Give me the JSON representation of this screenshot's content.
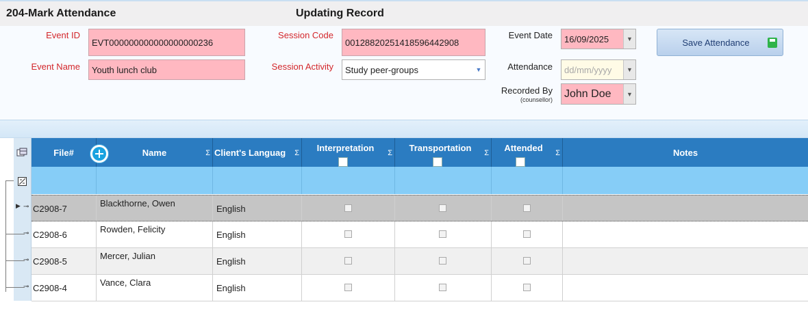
{
  "header": {
    "title": "204-Mark Attendance",
    "status": "Updating Record"
  },
  "form": {
    "event_id_label": "Event ID",
    "event_id_value": "EVT000000000000000000236",
    "event_name_label": "Event Name",
    "event_name_value": "Youth lunch club",
    "session_code_label": "Session Code",
    "session_code_value": "0012882025141859644290​8",
    "session_activity_label": "Session Activity",
    "session_activity_value": "Study peer-groups",
    "event_date_label": "Event Date",
    "event_date_value": "16/09/2025",
    "attendance_label": "Attendance",
    "attendance_placeholder": "dd/mm/yyyy",
    "recorded_by_label": "Recorded By",
    "recorded_by_sub": "(counsellor)",
    "recorded_by_value": "John Doe",
    "save_label": "Save Attendance"
  },
  "colors": {
    "accent": "#2b7cc1",
    "required": "#ffb8c1",
    "filter_row": "#86cdf7",
    "label_red": "#d3262a"
  },
  "grid": {
    "columns": [
      {
        "key": "file",
        "label": "File#"
      },
      {
        "key": "name",
        "label": "Name"
      },
      {
        "key": "language",
        "label": "Client's Languag"
      },
      {
        "key": "interpretation",
        "label": "Interpretation"
      },
      {
        "key": "transportation",
        "label": "Transportation"
      },
      {
        "key": "attended",
        "label": "Attended"
      },
      {
        "key": "notes",
        "label": "Notes"
      }
    ],
    "sigma": "Σ",
    "rows": [
      {
        "file": "C2908-7",
        "name": "Blackthorne, Owen",
        "language": "English",
        "current": true
      },
      {
        "file": "C2908-6",
        "name": "Rowden, Felicity",
        "language": "English",
        "current": false
      },
      {
        "file": "C2908-5",
        "name": "Mercer, Julian",
        "language": "English",
        "current": false
      },
      {
        "file": "C2908-4",
        "name": "Vance, Clara",
        "language": "English",
        "current": false
      }
    ]
  },
  "icons": {
    "add": "plus-circle-icon",
    "column_chooser": "column-chooser-icon",
    "filter_edit": "filter-edit-icon",
    "save": "floppy-disk-icon"
  }
}
